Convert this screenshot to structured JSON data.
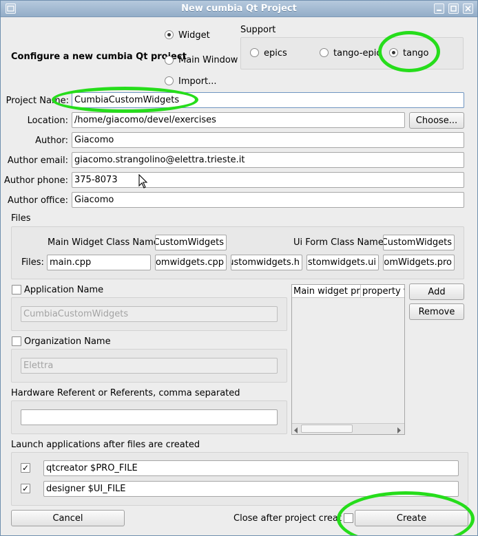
{
  "window": {
    "title": "New cumbia Qt Project"
  },
  "header": {
    "configure_label": "Configure a new cumbia Qt project"
  },
  "project_type": {
    "options": [
      {
        "label": "Widget",
        "selected": true
      },
      {
        "label": "Main Window",
        "selected": false
      },
      {
        "label": "Import...",
        "selected": false
      }
    ]
  },
  "support": {
    "title": "Support",
    "options": [
      {
        "label": "epics",
        "selected": false
      },
      {
        "label": "tango-epics",
        "selected": false
      },
      {
        "label": "tango",
        "selected": true
      }
    ]
  },
  "form": {
    "project_name": {
      "label": "Project Name:",
      "value": "CumbiaCustomWidgets"
    },
    "location": {
      "label": "Location:",
      "value": "/home/giacomo/devel/exercises",
      "button": "Choose..."
    },
    "author": {
      "label": "Author:",
      "value": "Giacomo"
    },
    "author_email": {
      "label": "Author email:",
      "value": "giacomo.strangolino@elettra.trieste.it"
    },
    "author_phone": {
      "label": "Author phone:",
      "value": "375-8073"
    },
    "author_office": {
      "label": "Author office:",
      "value": "Giacomo"
    }
  },
  "files": {
    "title": "Files",
    "main_widget_class_label": "Main Widget Class Name:",
    "main_widget_class_value": "CumbiaCustomWidgets",
    "ui_form_class_label": "Ui Form Class Name:",
    "ui_form_class_value": "CumbiaCustomWidgets",
    "files_label": "Files:",
    "file_names": [
      "main.cpp",
      "cumbiacustomwidgets.cpp",
      "cumbiacustomwidgets.h",
      "cumbiacustomwidgets.ui",
      "CumbiaCustomWidgets.pro"
    ]
  },
  "application_name": {
    "label": "Application Name",
    "checked": false,
    "value": "CumbiaCustomWidgets"
  },
  "organization_name": {
    "label": "Organization Name",
    "checked": false,
    "value": "Elettra"
  },
  "hardware": {
    "label": "Hardware Referent or Referents, comma separated",
    "value": ""
  },
  "properties_table": {
    "headers": [
      "Main widget prop",
      "property va"
    ],
    "add_label": "Add",
    "remove_label": "Remove"
  },
  "launch": {
    "title": "Launch applications after files are created",
    "items": [
      {
        "checked": true,
        "command": "qtcreator $PRO_FILE"
      },
      {
        "checked": true,
        "command": "designer $UI_FILE"
      }
    ]
  },
  "footer": {
    "cancel_label": "Cancel",
    "close_after_label": "Close after project creation",
    "close_after_checked": false,
    "create_label": "Create"
  },
  "colors": {
    "annotation_ring": "#26dd1b",
    "titlebar": "#93adc8"
  }
}
